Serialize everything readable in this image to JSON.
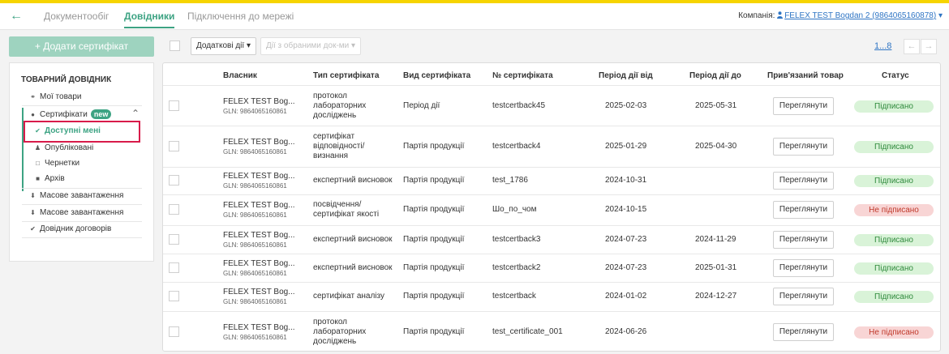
{
  "nav": {
    "back_icon": "←",
    "tabs": [
      {
        "label": "Документообіг"
      },
      {
        "label": "Довідники"
      },
      {
        "label": "Підключення до мережі"
      }
    ],
    "company_label": "Компанія:",
    "company_value": "FELEX TEST Bogdan 2 (9864065160878)",
    "company_caret": "▾"
  },
  "add_button_label": "+ Додати сертифікат",
  "sidebar": {
    "title": "ТОВАРНИЙ ДОВІДНИК",
    "my_goods": "Мої товари",
    "certificates": "Сертифікати",
    "new_badge": "new",
    "available": "Доступні мені",
    "published": "Опубліковані",
    "drafts": "Чернетки",
    "archive": "Архів",
    "bulk_upload_1": "Масове завантаження",
    "bulk_upload_2": "Масове завантаження",
    "contracts": "Довідник договорів"
  },
  "toolbar": {
    "additional": "Додаткові дії ▾",
    "selected_actions": "Дії з обраними док-ми ▾"
  },
  "pager": {
    "pages": "1...8",
    "prev": "←",
    "next": "→"
  },
  "table": {
    "headers": {
      "owner": "Власник",
      "cert_type": "Тип сертифіката",
      "cert_kind": "Вид сертифіката",
      "cert_no": "№ сертифіката",
      "valid_from": "Період дії від",
      "valid_to": "Період дії до",
      "linked": "Прив'язаний товар",
      "status": "Статус"
    },
    "rows": [
      {
        "owner": "FELEX TEST Bog...",
        "gln": "GLN: 9864065160861",
        "type": [
          "протокол",
          "лабораторних",
          "досліджень"
        ],
        "kind": "Період дії",
        "number": "testcertback45",
        "from": "2025-02-03",
        "to": "2025-05-31",
        "view": "Переглянути",
        "status": "Підписано",
        "ok": true
      },
      {
        "owner": "FELEX TEST Bog...",
        "gln": "GLN: 9864065160861",
        "type": [
          "сертифікат",
          "відповідності/",
          "визнання"
        ],
        "kind": "Партія продукції",
        "number": "testcertback4",
        "from": "2025-01-29",
        "to": "2025-04-30",
        "view": "Переглянути",
        "status": "Підписано",
        "ok": true
      },
      {
        "owner": "FELEX TEST Bog...",
        "gln": "GLN: 9864065160861",
        "type": [
          "експертний висновок"
        ],
        "kind": "Партія продукції",
        "number": "test_1786",
        "from": "2024-10-31",
        "to": "",
        "view": "Переглянути",
        "status": "Підписано",
        "ok": true
      },
      {
        "owner": "FELEX TEST Bog...",
        "gln": "GLN: 9864065160861",
        "type": [
          "посвідчення/",
          "сертифікат якості"
        ],
        "kind": "Партія продукції",
        "number": "Шо_по_чом",
        "from": "2024-10-15",
        "to": "",
        "view": "Переглянути",
        "status": "Не підписано",
        "ok": false
      },
      {
        "owner": "FELEX TEST Bog...",
        "gln": "GLN: 9864065160861",
        "type": [
          "експертний висновок"
        ],
        "kind": "Партія продукції",
        "number": "testcertback3",
        "from": "2024-07-23",
        "to": "2024-11-29",
        "view": "Переглянути",
        "status": "Підписано",
        "ok": true
      },
      {
        "owner": "FELEX TEST Bog...",
        "gln": "GLN: 9864065160861",
        "type": [
          "експертний висновок"
        ],
        "kind": "Партія продукції",
        "number": "testcertback2",
        "from": "2024-07-23",
        "to": "2025-01-31",
        "view": "Переглянути",
        "status": "Підписано",
        "ok": true
      },
      {
        "owner": "FELEX TEST Bog...",
        "gln": "GLN: 9864065160861",
        "type": [
          "сертифікат аналізу"
        ],
        "kind": "Партія продукції",
        "number": "testcertback",
        "from": "2024-01-02",
        "to": "2024-12-27",
        "view": "Переглянути",
        "status": "Підписано",
        "ok": true
      },
      {
        "owner": "FELEX TEST Bog...",
        "gln": "GLN: 9864065160861",
        "type": [
          "протокол",
          "лабораторних",
          "досліджень"
        ],
        "kind": "Партія продукції",
        "number": "test_certificate_001",
        "from": "2024-06-26",
        "to": "",
        "view": "Переглянути",
        "status": "Не підписано",
        "ok": false
      }
    ]
  },
  "colors": {
    "accent": "#3da383",
    "top_border": "#f6d400",
    "highlight": "#d81b4a"
  }
}
